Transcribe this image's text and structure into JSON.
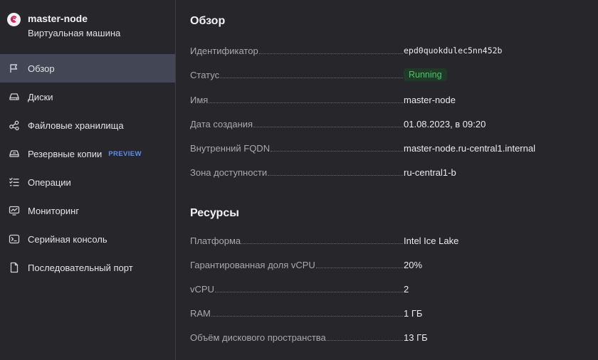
{
  "vm": {
    "name": "master-node",
    "type": "Виртуальная машина",
    "logo_icon": "debian-swirl-icon"
  },
  "nav": {
    "items": [
      {
        "label": "Обзор",
        "icon": "flag-icon",
        "active": true
      },
      {
        "label": "Диски",
        "icon": "disk-icon"
      },
      {
        "label": "Файловые хранилища",
        "icon": "share-icon"
      },
      {
        "label": "Резервные копии",
        "icon": "backup-icon",
        "badge": "PREVIEW"
      },
      {
        "label": "Операции",
        "icon": "list-check-icon"
      },
      {
        "label": "Мониторинг",
        "icon": "monitor-chart-icon"
      },
      {
        "label": "Серийная консоль",
        "icon": "terminal-icon"
      },
      {
        "label": "Последовательный порт",
        "icon": "file-icon"
      }
    ]
  },
  "overview": {
    "title": "Обзор",
    "rows": [
      {
        "label": "Идентификатор",
        "value": "epd0quokdulec5nn452b"
      },
      {
        "label": "Статус",
        "value": "Running"
      },
      {
        "label": "Имя",
        "value": "master-node"
      },
      {
        "label": "Дата создания",
        "value": "01.08.2023, в 09:20"
      },
      {
        "label": "Внутренний FQDN",
        "value": "master-node.ru-central1.internal"
      },
      {
        "label": "Зона доступности",
        "value": "ru-central1-b"
      }
    ]
  },
  "resources": {
    "title": "Ресурсы",
    "rows": [
      {
        "label": "Платформа",
        "value": "Intel Ice Lake"
      },
      {
        "label": "Гарантированная доля vCPU",
        "value": "20%"
      },
      {
        "label": "vCPU",
        "value": "2"
      },
      {
        "label": "RAM",
        "value": "1 ГБ"
      },
      {
        "label": "Объём дискового пространства",
        "value": "13 ГБ"
      }
    ]
  },
  "colors": {
    "background": "#27262b",
    "active_nav": "#434655",
    "status_running": "#4fc36b",
    "preview_badge": "#5d8ef0"
  }
}
